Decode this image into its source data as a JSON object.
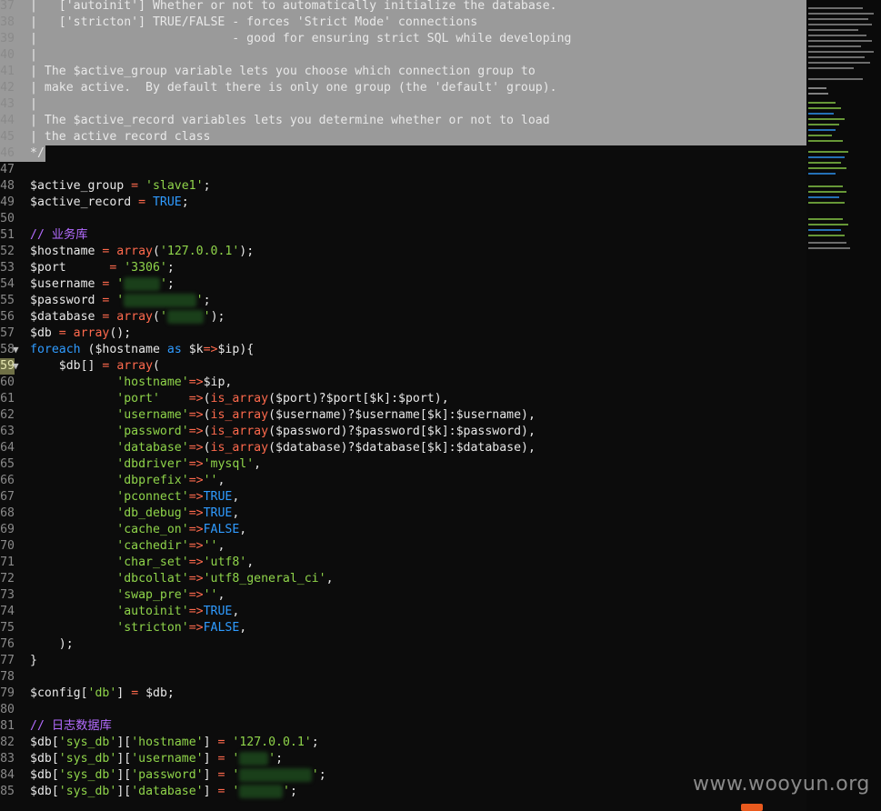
{
  "gutter_start": 37,
  "lines": [
    {
      "n": "37",
      "hl": true,
      "tokens": [
        [
          "d",
          "|   ['autoinit'] Whether or not to automatically initialize the database."
        ]
      ]
    },
    {
      "n": "38",
      "hl": true,
      "tokens": [
        [
          "d",
          "|   ['stricton'] TRUE/FALSE - forces 'Strict Mode' connections"
        ]
      ]
    },
    {
      "n": "39",
      "hl": true,
      "tokens": [
        [
          "d",
          "|                           - good for ensuring strict SQL while developing"
        ]
      ]
    },
    {
      "n": "40",
      "hl": true,
      "tokens": [
        [
          "d",
          "|"
        ]
      ]
    },
    {
      "n": "41",
      "hl": true,
      "tokens": [
        [
          "d",
          "| The $active_group variable lets you choose which connection group to"
        ]
      ]
    },
    {
      "n": "42",
      "hl": true,
      "tokens": [
        [
          "d",
          "| make active.  By default there is only one group (the 'default' group)."
        ]
      ]
    },
    {
      "n": "43",
      "hl": true,
      "tokens": [
        [
          "d",
          "|"
        ]
      ]
    },
    {
      "n": "44",
      "hl": true,
      "tokens": [
        [
          "d",
          "| The $active_record variables lets you determine whether or not to load"
        ]
      ]
    },
    {
      "n": "45",
      "hl": true,
      "tokens": [
        [
          "d",
          "| the active record class"
        ]
      ]
    },
    {
      "n": "46",
      "hl": true,
      "hlw": "short",
      "tokens": [
        [
          "d",
          "*/"
        ]
      ]
    },
    {
      "n": "47",
      "tokens": []
    },
    {
      "n": "48",
      "tokens": [
        [
          "v",
          "$active_group"
        ],
        [
          "k",
          " = "
        ],
        [
          "s",
          "'slave1'"
        ],
        [
          "d",
          ";"
        ]
      ]
    },
    {
      "n": "49",
      "tokens": [
        [
          "v",
          "$active_record"
        ],
        [
          "k",
          " = "
        ],
        [
          "c",
          "TRUE"
        ],
        [
          "d",
          ";"
        ]
      ]
    },
    {
      "n": "50",
      "tokens": []
    },
    {
      "n": "51",
      "tokens": [
        [
          "m",
          "// 业务库"
        ]
      ]
    },
    {
      "n": "52",
      "tokens": [
        [
          "v",
          "$hostname"
        ],
        [
          "k",
          " = "
        ],
        [
          "f",
          "array"
        ],
        [
          "d",
          "("
        ],
        [
          "s",
          "'127.0.0.1'"
        ],
        [
          "d",
          ");"
        ]
      ]
    },
    {
      "n": "53",
      "tokens": [
        [
          "v",
          "$port     "
        ],
        [
          "k",
          " = "
        ],
        [
          "s",
          "'3306'"
        ],
        [
          "d",
          ";"
        ]
      ]
    },
    {
      "n": "54",
      "tokens": [
        [
          "v",
          "$username"
        ],
        [
          "k",
          " = "
        ],
        [
          "s",
          "'"
        ],
        [
          "b",
          "     "
        ],
        [
          "s",
          "'"
        ],
        [
          "d",
          ";"
        ]
      ]
    },
    {
      "n": "55",
      "tokens": [
        [
          "v",
          "$password"
        ],
        [
          "k",
          " = "
        ],
        [
          "s",
          "'"
        ],
        [
          "b",
          "          "
        ],
        [
          "s",
          "'"
        ],
        [
          "d",
          ";"
        ]
      ]
    },
    {
      "n": "56",
      "tokens": [
        [
          "v",
          "$database"
        ],
        [
          "k",
          " = "
        ],
        [
          "f",
          "array"
        ],
        [
          "d",
          "("
        ],
        [
          "s",
          "'"
        ],
        [
          "b",
          "     "
        ],
        [
          "s",
          "'"
        ],
        [
          "d",
          ");"
        ]
      ]
    },
    {
      "n": "57",
      "tokens": [
        [
          "v",
          "$db"
        ],
        [
          "k",
          " = "
        ],
        [
          "f",
          "array"
        ],
        [
          "d",
          "();"
        ]
      ]
    },
    {
      "n": "58",
      "fold": true,
      "tokens": [
        [
          "c",
          "foreach"
        ],
        [
          "d",
          " ("
        ],
        [
          "v",
          "$hostname"
        ],
        [
          "c",
          " as "
        ],
        [
          "v",
          "$k"
        ],
        [
          "k",
          "=>"
        ],
        [
          "v",
          "$ip"
        ],
        [
          "d",
          "){"
        ]
      ]
    },
    {
      "n": "59",
      "fold": true,
      "cur": true,
      "tokens": [
        [
          "d",
          "    "
        ],
        [
          "v",
          "$db"
        ],
        [
          "d",
          "[]"
        ],
        [
          "k",
          " = "
        ],
        [
          "f",
          "array"
        ],
        [
          "d",
          "("
        ]
      ]
    },
    {
      "n": "60",
      "tokens": [
        [
          "d",
          "            "
        ],
        [
          "s",
          "'hostname'"
        ],
        [
          "k",
          "=>"
        ],
        [
          "v",
          "$ip"
        ],
        [
          "d",
          ","
        ]
      ]
    },
    {
      "n": "61",
      "tokens": [
        [
          "d",
          "            "
        ],
        [
          "s",
          "'port'    "
        ],
        [
          "k",
          "=>"
        ],
        [
          "d",
          "("
        ],
        [
          "f",
          "is_array"
        ],
        [
          "d",
          "("
        ],
        [
          "v",
          "$port"
        ],
        [
          "d",
          ")?"
        ],
        [
          "v",
          "$port"
        ],
        [
          "d",
          "["
        ],
        [
          "v",
          "$k"
        ],
        [
          "d",
          "]:"
        ],
        [
          "v",
          "$port"
        ],
        [
          "d",
          "),"
        ]
      ]
    },
    {
      "n": "62",
      "tokens": [
        [
          "d",
          "            "
        ],
        [
          "s",
          "'username'"
        ],
        [
          "k",
          "=>"
        ],
        [
          "d",
          "("
        ],
        [
          "f",
          "is_array"
        ],
        [
          "d",
          "("
        ],
        [
          "v",
          "$username"
        ],
        [
          "d",
          ")?"
        ],
        [
          "v",
          "$username"
        ],
        [
          "d",
          "["
        ],
        [
          "v",
          "$k"
        ],
        [
          "d",
          "]:"
        ],
        [
          "v",
          "$username"
        ],
        [
          "d",
          "),"
        ]
      ]
    },
    {
      "n": "63",
      "tokens": [
        [
          "d",
          "            "
        ],
        [
          "s",
          "'password'"
        ],
        [
          "k",
          "=>"
        ],
        [
          "d",
          "("
        ],
        [
          "f",
          "is_array"
        ],
        [
          "d",
          "("
        ],
        [
          "v",
          "$password"
        ],
        [
          "d",
          ")?"
        ],
        [
          "v",
          "$password"
        ],
        [
          "d",
          "["
        ],
        [
          "v",
          "$k"
        ],
        [
          "d",
          "]:"
        ],
        [
          "v",
          "$password"
        ],
        [
          "d",
          "),"
        ]
      ]
    },
    {
      "n": "64",
      "tokens": [
        [
          "d",
          "            "
        ],
        [
          "s",
          "'database'"
        ],
        [
          "k",
          "=>"
        ],
        [
          "d",
          "("
        ],
        [
          "f",
          "is_array"
        ],
        [
          "d",
          "("
        ],
        [
          "v",
          "$database"
        ],
        [
          "d",
          ")?"
        ],
        [
          "v",
          "$database"
        ],
        [
          "d",
          "["
        ],
        [
          "v",
          "$k"
        ],
        [
          "d",
          "]:"
        ],
        [
          "v",
          "$database"
        ],
        [
          "d",
          "),"
        ]
      ]
    },
    {
      "n": "65",
      "tokens": [
        [
          "d",
          "            "
        ],
        [
          "s",
          "'dbdriver'"
        ],
        [
          "k",
          "=>"
        ],
        [
          "s",
          "'mysql'"
        ],
        [
          "d",
          ","
        ]
      ]
    },
    {
      "n": "66",
      "tokens": [
        [
          "d",
          "            "
        ],
        [
          "s",
          "'dbprefix'"
        ],
        [
          "k",
          "=>"
        ],
        [
          "s",
          "''"
        ],
        [
          "d",
          ","
        ]
      ]
    },
    {
      "n": "67",
      "tokens": [
        [
          "d",
          "            "
        ],
        [
          "s",
          "'pconnect'"
        ],
        [
          "k",
          "=>"
        ],
        [
          "c",
          "TRUE"
        ],
        [
          "d",
          ","
        ]
      ]
    },
    {
      "n": "68",
      "tokens": [
        [
          "d",
          "            "
        ],
        [
          "s",
          "'db_debug'"
        ],
        [
          "k",
          "=>"
        ],
        [
          "c",
          "TRUE"
        ],
        [
          "d",
          ","
        ]
      ]
    },
    {
      "n": "69",
      "tokens": [
        [
          "d",
          "            "
        ],
        [
          "s",
          "'cache_on'"
        ],
        [
          "k",
          "=>"
        ],
        [
          "c",
          "FALSE"
        ],
        [
          "d",
          ","
        ]
      ]
    },
    {
      "n": "70",
      "tokens": [
        [
          "d",
          "            "
        ],
        [
          "s",
          "'cachedir'"
        ],
        [
          "k",
          "=>"
        ],
        [
          "s",
          "''"
        ],
        [
          "d",
          ","
        ]
      ]
    },
    {
      "n": "71",
      "tokens": [
        [
          "d",
          "            "
        ],
        [
          "s",
          "'char_set'"
        ],
        [
          "k",
          "=>"
        ],
        [
          "s",
          "'utf8'"
        ],
        [
          "d",
          ","
        ]
      ]
    },
    {
      "n": "72",
      "tokens": [
        [
          "d",
          "            "
        ],
        [
          "s",
          "'dbcollat'"
        ],
        [
          "k",
          "=>"
        ],
        [
          "s",
          "'utf8_general_ci'"
        ],
        [
          "d",
          ","
        ]
      ]
    },
    {
      "n": "73",
      "tokens": [
        [
          "d",
          "            "
        ],
        [
          "s",
          "'swap_pre'"
        ],
        [
          "k",
          "=>"
        ],
        [
          "s",
          "''"
        ],
        [
          "d",
          ","
        ]
      ]
    },
    {
      "n": "74",
      "tokens": [
        [
          "d",
          "            "
        ],
        [
          "s",
          "'autoinit'"
        ],
        [
          "k",
          "=>"
        ],
        [
          "c",
          "TRUE"
        ],
        [
          "d",
          ","
        ]
      ]
    },
    {
      "n": "75",
      "tokens": [
        [
          "d",
          "            "
        ],
        [
          "s",
          "'stricton'"
        ],
        [
          "k",
          "=>"
        ],
        [
          "c",
          "FALSE"
        ],
        [
          "d",
          ","
        ]
      ]
    },
    {
      "n": "76",
      "tokens": [
        [
          "d",
          "    );"
        ]
      ]
    },
    {
      "n": "77",
      "tokens": [
        [
          "d",
          "}"
        ]
      ]
    },
    {
      "n": "78",
      "tokens": []
    },
    {
      "n": "79",
      "tokens": [
        [
          "v",
          "$config"
        ],
        [
          "d",
          "["
        ],
        [
          "s",
          "'db'"
        ],
        [
          "d",
          "]"
        ],
        [
          "k",
          " = "
        ],
        [
          "v",
          "$db"
        ],
        [
          "d",
          ";"
        ]
      ]
    },
    {
      "n": "80",
      "tokens": []
    },
    {
      "n": "81",
      "tokens": [
        [
          "m",
          "// 日志数据库"
        ]
      ]
    },
    {
      "n": "82",
      "tokens": [
        [
          "v",
          "$db"
        ],
        [
          "d",
          "["
        ],
        [
          "s",
          "'sys_db'"
        ],
        [
          "d",
          "]["
        ],
        [
          "s",
          "'hostname'"
        ],
        [
          "d",
          "]"
        ],
        [
          "k",
          " = "
        ],
        [
          "s",
          "'127.0.0.1'"
        ],
        [
          "d",
          ";"
        ]
      ]
    },
    {
      "n": "83",
      "tokens": [
        [
          "v",
          "$db"
        ],
        [
          "d",
          "["
        ],
        [
          "s",
          "'sys_db'"
        ],
        [
          "d",
          "]["
        ],
        [
          "s",
          "'username'"
        ],
        [
          "d",
          "]"
        ],
        [
          "k",
          " = "
        ],
        [
          "s",
          "'"
        ],
        [
          "b",
          "    "
        ],
        [
          "s",
          "'"
        ],
        [
          "d",
          ";"
        ]
      ]
    },
    {
      "n": "84",
      "tokens": [
        [
          "v",
          "$db"
        ],
        [
          "d",
          "["
        ],
        [
          "s",
          "'sys_db'"
        ],
        [
          "d",
          "]["
        ],
        [
          "s",
          "'password'"
        ],
        [
          "d",
          "]"
        ],
        [
          "k",
          " = "
        ],
        [
          "s",
          "'"
        ],
        [
          "b",
          "          "
        ],
        [
          "s",
          "'"
        ],
        [
          "d",
          ";"
        ]
      ]
    },
    {
      "n": "85",
      "tokens": [
        [
          "v",
          "$db"
        ],
        [
          "d",
          "["
        ],
        [
          "s",
          "'sys_db'"
        ],
        [
          "d",
          "]["
        ],
        [
          "s",
          "'database'"
        ],
        [
          "d",
          "]"
        ],
        [
          "k",
          " = "
        ],
        [
          "s",
          "'"
        ],
        [
          "b",
          "      "
        ],
        [
          "s",
          "'"
        ],
        [
          "d",
          ";"
        ]
      ]
    }
  ],
  "watermark": "www.wooyun.org",
  "colors": {
    "background": "#0c0c0c",
    "selection": "#9a9a9a",
    "string": "#8fd44a",
    "keyword": "#ff6a4d",
    "constant": "#2f9bff",
    "comment": "#b46cff"
  }
}
